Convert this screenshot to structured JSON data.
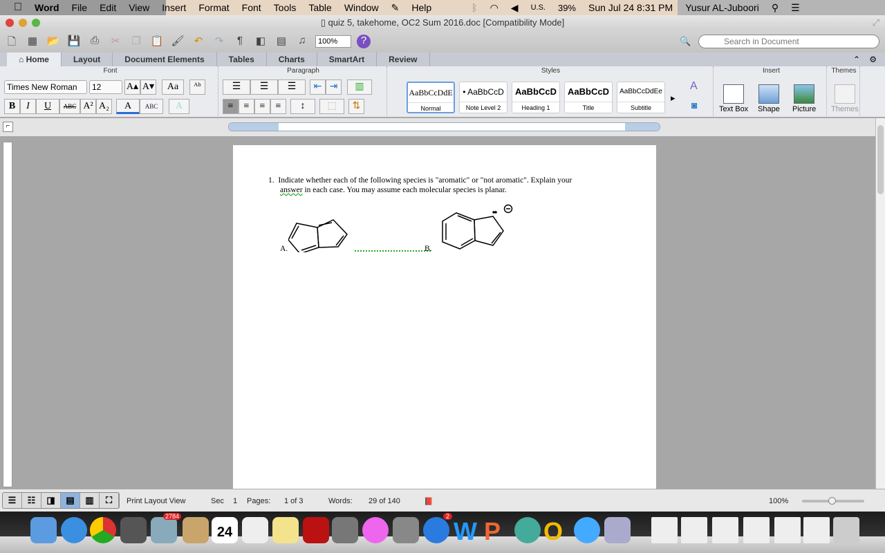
{
  "menubar": {
    "items": [
      "Word",
      "File",
      "Edit",
      "View",
      "Insert",
      "Format",
      "Font",
      "Tools",
      "Table",
      "Window",
      "Help"
    ],
    "status": {
      "input": "U.S.",
      "battery": "39%",
      "datetime": "Sun Jul 24  8:31 PM",
      "user": "Yusur AL-Juboori"
    }
  },
  "window": {
    "title": "quiz 5, takehome, OC2 Sum 2016.doc [Compatibility Mode]"
  },
  "toolbar": {
    "zoom": "100%",
    "search_placeholder": "Search in Document"
  },
  "tabs": [
    "Home",
    "Layout",
    "Document Elements",
    "Tables",
    "Charts",
    "SmartArt",
    "Review"
  ],
  "ribbon": {
    "font": {
      "label": "Font",
      "name": "Times New Roman",
      "size": "12"
    },
    "paragraph": {
      "label": "Paragraph"
    },
    "styles": {
      "label": "Styles",
      "items": [
        {
          "sample": "AaBbCcDdE",
          "name": "Normal"
        },
        {
          "sample": "• AaBbCcD",
          "name": "Note Level 2"
        },
        {
          "sample": "AaBbCcD",
          "name": "Heading 1"
        },
        {
          "sample": "AaBbCcD",
          "name": "Title"
        },
        {
          "sample": "AaBbCcDdEe",
          "name": "Subtitle"
        }
      ]
    },
    "insert": {
      "label": "Insert",
      "items": [
        "Text Box",
        "Shape",
        "Picture"
      ]
    },
    "themes": {
      "label": "Themes",
      "item": "Themes"
    }
  },
  "document": {
    "question_num": "1.",
    "question_line1": "Indicate whether each of the following species is \"aromatic\" or \"not aromatic\".  Explain your",
    "question_line2_word": "answer",
    "question_line2": " in each case.  You may assume each molecular species is planar.",
    "label_a": "A.",
    "label_b": "B."
  },
  "status": {
    "view": "Print Layout View",
    "sec_label": "Sec",
    "sec": "1",
    "pages_label": "Pages:",
    "pages": "1 of 3",
    "words_label": "Words:",
    "words": "29 of 140",
    "zoom": "100%",
    "zoom_level": 1.0
  },
  "dock": {
    "mail_badge": "2784",
    "calendar_day": "24",
    "appstore_badge": "2"
  }
}
